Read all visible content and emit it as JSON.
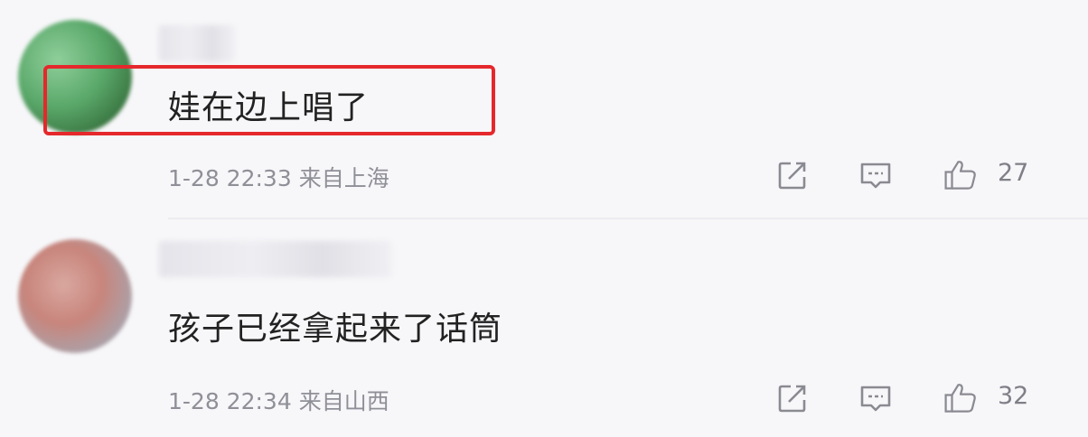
{
  "comments": [
    {
      "text": "娃在边上唱了",
      "time": "1-28 22:33",
      "location": "来自上海",
      "likes": "27"
    },
    {
      "text": "孩子已经拿起来了话筒",
      "time": "1-28 22:34",
      "location": "来自山西",
      "likes": "32"
    }
  ],
  "icons": {
    "share": "share-icon",
    "reply": "comment-icon",
    "like": "thumbs-up-icon"
  },
  "colors": {
    "highlight_border": "#e5282c",
    "meta_text": "#8f8f98"
  }
}
